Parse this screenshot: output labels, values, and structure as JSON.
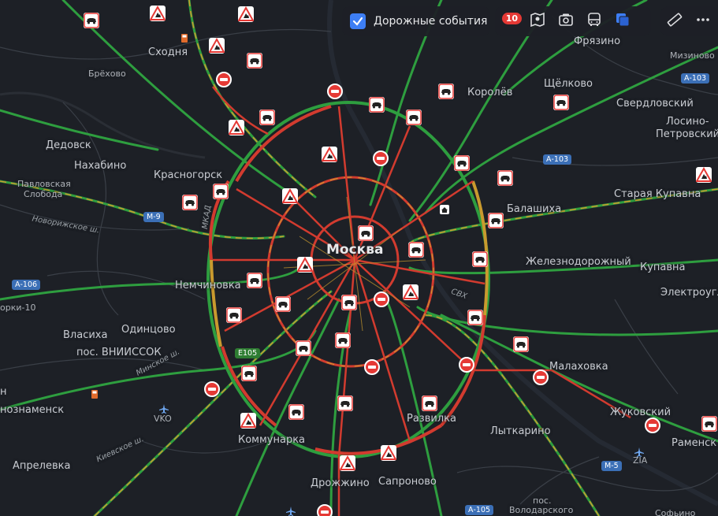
{
  "toolbar": {
    "traffic_events_label": "Дорожные события",
    "traffic_events_checked": true,
    "events_count": "10"
  },
  "places": {
    "moskva": "Москва",
    "skhodnya": "Сходня",
    "brekhovo": "Брёхово",
    "dedovsk": "Дедовск",
    "nakhabino": "Нахабино",
    "krasnogorsk": "Красногорск",
    "pavlovskaya_sloboda_1": "Павловская",
    "pavlovskaya_sloboda_2": "Слобода",
    "korolev": "Королёв",
    "shchelkovo": "Щёлково",
    "fryazino": "Фрязино",
    "mizinovo": "Мизиново",
    "sverdlovsky": "Свердловский",
    "losino_1": "Лосино-",
    "losino_2": "Петровский",
    "balashikha": "Балашиха",
    "staraya_kupavna": "Старая Купавна",
    "zheleznodorozhny": "Железнодорожный",
    "kupavna": "Купавна",
    "elektrougli": "Электроугл",
    "nemchinovka": "Немчиновка",
    "odintsovo": "Одинцово",
    "vlasikha": "Власиха",
    "vniissok": "пос. ВНИИССОК",
    "gorki": "орки-10",
    "znamensk": "нознаменск",
    "aprelevka": "Апрелевка",
    "kommunarka": "Коммунарка",
    "drozhzhino": "Дрожжино",
    "saprono": "Сапроново",
    "razvilka": "Развилка",
    "lytkarino": "Лыткарино",
    "malakhovka": "Малаховка",
    "zhukovsky": "Жуковский",
    "ramensk": "Раменск",
    "volodarsky_1": "пос.",
    "volodarsky_2": "Володарского",
    "sofyino": "Софьино",
    "vko": "VKO",
    "zia": "ZIA",
    "kh": "н"
  },
  "roads": {
    "m9": "М-9",
    "a106": "А-106",
    "a103_1": "А-103",
    "a103_2": "А-103",
    "e105": "E105",
    "m5": "М-5",
    "a105": "А-105",
    "mkad": "МКАД",
    "novorizhskoe": "Новорижское ш.",
    "minskoe": "Минское ш.",
    "kievskoe": "Киевское ш.",
    "svkh": "СВХ"
  },
  "colors": {
    "background": "#1d2026",
    "traffic_green": "#2e9e3f",
    "traffic_yellow": "#c99a2e",
    "traffic_red": "#d23b2f",
    "closure": "#e53935",
    "accent": "#3d7ef5"
  }
}
